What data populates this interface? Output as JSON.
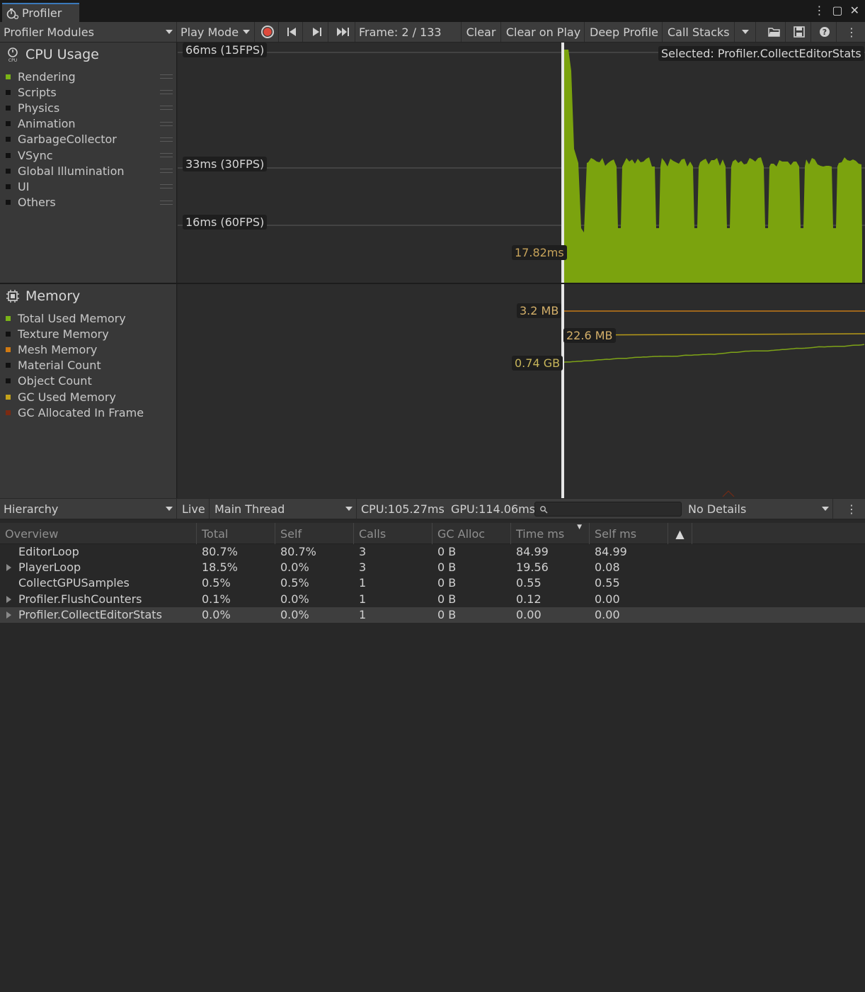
{
  "window": {
    "tab_title": "Profiler"
  },
  "toolbar": {
    "modules": "Profiler Modules",
    "play_mode": "Play Mode",
    "frame": "Frame: 2 / 133",
    "clear": "Clear",
    "clear_on_play": "Clear on Play",
    "deep_profile": "Deep Profile",
    "call_stacks": "Call Stacks"
  },
  "cpu": {
    "title": "CPU Usage",
    "legend": [
      {
        "label": "Rendering",
        "color": "#7ab317"
      },
      {
        "label": "Scripts",
        "color": "#111111"
      },
      {
        "label": "Physics",
        "color": "#111111"
      },
      {
        "label": "Animation",
        "color": "#111111"
      },
      {
        "label": "GarbageCollector",
        "color": "#111111"
      },
      {
        "label": "VSync",
        "color": "#111111"
      },
      {
        "label": "Global Illumination",
        "color": "#111111"
      },
      {
        "label": "UI",
        "color": "#111111"
      },
      {
        "label": "Others",
        "color": "#111111"
      }
    ],
    "label_66": "66ms (15FPS)",
    "label_33": "33ms (30FPS)",
    "label_16": "16ms (60FPS)",
    "selected": "Selected: Profiler.CollectEditorStats",
    "frame_value": "17.82ms",
    "fill_color": "#7ba30e"
  },
  "memory": {
    "title": "Memory",
    "legend": [
      {
        "label": "Total Used Memory",
        "color": "#7ab317"
      },
      {
        "label": "Texture Memory",
        "color": "#111111"
      },
      {
        "label": "Mesh Memory",
        "color": "#d17a12"
      },
      {
        "label": "Material Count",
        "color": "#111111"
      },
      {
        "label": "Object Count",
        "color": "#111111"
      },
      {
        "label": "GC Used Memory",
        "color": "#c3a21a"
      },
      {
        "label": "GC Allocated In Frame",
        "color": "#7a2a12"
      }
    ],
    "val_mesh": "3.2 MB",
    "val_gc": "22.6 MB",
    "val_total": "0.74 GB"
  },
  "hierarchy": {
    "view": "Hierarchy",
    "live": "Live",
    "thread": "Main Thread",
    "cpu": "CPU:105.27ms",
    "gpu": "GPU:114.06ms",
    "details": "No Details",
    "columns": [
      "Overview",
      "Total",
      "Self",
      "Calls",
      "GC Alloc",
      "Time ms",
      "Self ms"
    ],
    "rows": [
      {
        "name": "EditorLoop",
        "total": "80.7%",
        "self": "80.7%",
        "calls": "3",
        "gc": "0 B",
        "time": "84.99",
        "selfms": "84.99",
        "expand": false
      },
      {
        "name": "PlayerLoop",
        "total": "18.5%",
        "self": "0.0%",
        "calls": "3",
        "gc": "0 B",
        "time": "19.56",
        "selfms": "0.08",
        "expand": true
      },
      {
        "name": "CollectGPUSamples",
        "total": "0.5%",
        "self": "0.5%",
        "calls": "1",
        "gc": "0 B",
        "time": "0.55",
        "selfms": "0.55",
        "expand": false
      },
      {
        "name": "Profiler.FlushCounters",
        "total": "0.1%",
        "self": "0.0%",
        "calls": "1",
        "gc": "0 B",
        "time": "0.12",
        "selfms": "0.00",
        "expand": true
      },
      {
        "name": "Profiler.CollectEditorStats",
        "total": "0.0%",
        "self": "0.0%",
        "calls": "1",
        "gc": "0 B",
        "time": "0.00",
        "selfms": "0.00",
        "expand": true
      }
    ]
  }
}
